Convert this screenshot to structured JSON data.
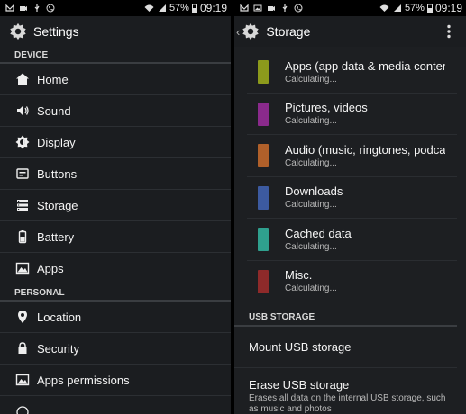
{
  "status": {
    "battery": "57%",
    "time": "09:19"
  },
  "left": {
    "title": "Settings",
    "sections": {
      "device": "DEVICE",
      "personal": "PERSONAL"
    },
    "items": [
      {
        "label": "Home",
        "icon": "home-icon"
      },
      {
        "label": "Sound",
        "icon": "speaker-icon"
      },
      {
        "label": "Display",
        "icon": "brightness-icon"
      },
      {
        "label": "Buttons",
        "icon": "buttons-icon"
      },
      {
        "label": "Storage",
        "icon": "storage-icon"
      },
      {
        "label": "Battery",
        "icon": "battery-icon"
      },
      {
        "label": "Apps",
        "icon": "apps-icon"
      },
      {
        "label": "Location",
        "icon": "location-pin-icon"
      },
      {
        "label": "Security",
        "icon": "lock-icon"
      },
      {
        "label": "Apps permissions",
        "icon": "apps-permissions-icon"
      }
    ]
  },
  "right": {
    "title": "Storage",
    "items": [
      {
        "title": "Apps (app data & media content)",
        "sub": "Calculating...",
        "color": "#8c9a1c"
      },
      {
        "title": "Pictures, videos",
        "sub": "Calculating...",
        "color": "#8a2a8c"
      },
      {
        "title": "Audio (music, ringtones, podcasts, etc.)",
        "sub": "Calculating...",
        "color": "#b0602a"
      },
      {
        "title": "Downloads",
        "sub": "Calculating...",
        "color": "#3c5aa0"
      },
      {
        "title": "Cached data",
        "sub": "Calculating...",
        "color": "#2fa08e"
      },
      {
        "title": "Misc.",
        "sub": "Calculating...",
        "color": "#8e2a2a"
      }
    ],
    "usb": {
      "header": "USB STORAGE",
      "mount": "Mount USB storage",
      "erase": "Erase USB storage",
      "erase_sub": "Erases all data on the internal USB storage, such as music and photos"
    }
  }
}
